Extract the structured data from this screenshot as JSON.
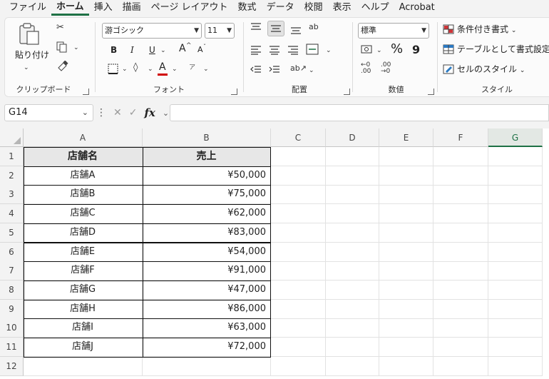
{
  "menu": {
    "items": [
      "ファイル",
      "ホーム",
      "挿入",
      "描画",
      "ページ レイアウト",
      "数式",
      "データ",
      "校閲",
      "表示",
      "ヘルプ",
      "Acrobat"
    ],
    "active_index": 1
  },
  "ribbon": {
    "clipboard": {
      "paste_label": "貼り付け",
      "group_label": "クリップボード"
    },
    "font": {
      "font_name": "游ゴシック",
      "font_size": "11",
      "bold": "B",
      "italic": "I",
      "underline": "U",
      "grow": "A",
      "shrink": "A",
      "group_label": "フォント"
    },
    "alignment": {
      "group_label": "配置"
    },
    "number": {
      "format": "標準",
      "percent": "%",
      "comma": "9",
      "group_label": "数値"
    },
    "styles": {
      "conditional": "条件付き書式",
      "table": "テーブルとして書式設定",
      "cell_styles": "セルのスタイル",
      "group_label": "スタイル"
    }
  },
  "formula_bar": {
    "name_box": "G14",
    "fx": "fx",
    "formula": ""
  },
  "sheet": {
    "columns": [
      "A",
      "B",
      "C",
      "D",
      "E",
      "F",
      "G"
    ],
    "selected_column": "G",
    "rows": [
      "1",
      "2",
      "3",
      "4",
      "5",
      "6",
      "7",
      "8",
      "9",
      "10",
      "11",
      "12"
    ],
    "table": {
      "headers": [
        "店舗名",
        "売上"
      ],
      "data": [
        [
          "店舗A",
          "¥50,000"
        ],
        [
          "店舗B",
          "¥75,000"
        ],
        [
          "店舗C",
          "¥62,000"
        ],
        [
          "店舗D",
          "¥83,000"
        ],
        [
          "店舗E",
          "¥54,000"
        ],
        [
          "店舗F",
          "¥91,000"
        ],
        [
          "店舗G",
          "¥47,000"
        ],
        [
          "店舗H",
          "¥86,000"
        ],
        [
          "店舗I",
          "¥63,000"
        ],
        [
          "店舗J",
          "¥72,000"
        ]
      ]
    }
  },
  "colors": {
    "accent": "#1e7145",
    "font_color": "#d00000"
  }
}
